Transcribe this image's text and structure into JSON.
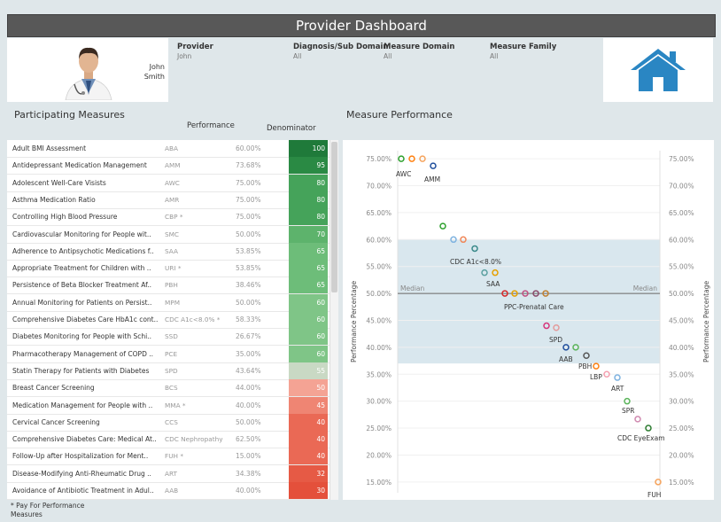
{
  "header": {
    "title": "Provider Dashboard",
    "provider_name": "John\nSmith",
    "filters": [
      {
        "label": "Provider",
        "value": "John"
      },
      {
        "label": "Diagnosis/Sub Domain",
        "value": "All"
      },
      {
        "label": "Measure Domain",
        "value": "All"
      },
      {
        "label": "Measure Family",
        "value": "All"
      }
    ],
    "home_icon": "home-icon",
    "accent_color": "#2a86c3"
  },
  "left_panel": {
    "title": "Participating Measures",
    "col_performance": "Performance",
    "col_denominator": "Denominator",
    "footnote_line1": "* Pay For Performance",
    "footnote_line2": "Measures",
    "rows": [
      {
        "name": "Adult BMI Assessment",
        "abbr": "ABA",
        "perf": "60.00%",
        "denom": "100",
        "color": "#1f7a3a"
      },
      {
        "name": "Antidepressant Medication Management",
        "abbr": "AMM",
        "perf": "73.68%",
        "denom": "95",
        "color": "#2a8a44"
      },
      {
        "name": "Adolescent Well-Care Visists",
        "abbr": "AWC",
        "perf": "75.00%",
        "denom": "80",
        "color": "#45a35a"
      },
      {
        "name": "Asthma Medication Ratio",
        "abbr": "AMR",
        "perf": "75.00%",
        "denom": "80",
        "color": "#45a35a"
      },
      {
        "name": "Controlling High Blood Pressure",
        "abbr": "CBP *",
        "perf": "75.00%",
        "denom": "80",
        "color": "#45a35a"
      },
      {
        "name": "Cardiovascular Monitoring for People wit..",
        "abbr": "SMC",
        "perf": "50.00%",
        "denom": "70",
        "color": "#5db36c"
      },
      {
        "name": "Adherence to Antipsychotic Medications f..",
        "abbr": "SAA",
        "perf": "53.85%",
        "denom": "65",
        "color": "#6dbd79"
      },
      {
        "name": "Appropriate Treatment for Children with ..",
        "abbr": "URI *",
        "perf": "53.85%",
        "denom": "65",
        "color": "#6dbd79"
      },
      {
        "name": "Persistence of Beta Blocker Treatment Af..",
        "abbr": "PBH",
        "perf": "38.46%",
        "denom": "65",
        "color": "#6dbd79"
      },
      {
        "name": "Annual Monitoring for Patients on Persist..",
        "abbr": "MPM",
        "perf": "50.00%",
        "denom": "60",
        "color": "#7fc587"
      },
      {
        "name": "Comprehensive Diabetes Care HbA1c cont..",
        "abbr": "CDC A1c<8.0% *",
        "perf": "58.33%",
        "denom": "60",
        "color": "#7fc587"
      },
      {
        "name": "Diabetes Monitoring  for People with Schi..",
        "abbr": "SSD",
        "perf": "26.67%",
        "denom": "60",
        "color": "#7fc587"
      },
      {
        "name": "Pharmacotherapy Management of COPD ..",
        "abbr": "PCE",
        "perf": "35.00%",
        "denom": "60",
        "color": "#7fc587"
      },
      {
        "name": "Statin Therapy for Patients with Diabetes",
        "abbr": "SPD",
        "perf": "43.64%",
        "denom": "55",
        "color": "#c9d9c4"
      },
      {
        "name": "Breast Cancer Screening",
        "abbr": "BCS",
        "perf": "44.00%",
        "denom": "50",
        "color": "#f4a394"
      },
      {
        "name": "Medication Management for People with ..",
        "abbr": "MMA *",
        "perf": "40.00%",
        "denom": "45",
        "color": "#ef8573"
      },
      {
        "name": "Cervical Cancer Screening",
        "abbr": "CCS",
        "perf": "50.00%",
        "denom": "40",
        "color": "#ea6955"
      },
      {
        "name": "Comprehensive Diabetes Care: Medical At..",
        "abbr": "CDC Nephropathy",
        "perf": "62.50%",
        "denom": "40",
        "color": "#ea6955"
      },
      {
        "name": "Follow-Up after Hospitalization for Ment..",
        "abbr": "FUH *",
        "perf": "15.00%",
        "denom": "40",
        "color": "#ea6955"
      },
      {
        "name": "Disease-Modifying Anti-Rheumatic Drug ..",
        "abbr": "ART",
        "perf": "34.38%",
        "denom": "32",
        "color": "#e65a45"
      },
      {
        "name": "Avoidance of Antibiotic Treatment in Adul..",
        "abbr": "AAB",
        "perf": "40.00%",
        "denom": "30",
        "color": "#e4503b"
      }
    ]
  },
  "right_panel": {
    "title": "Measure Performance"
  },
  "chart_data": {
    "type": "scatter",
    "title": "Measure Performance",
    "ylabel": "Performance Percentage",
    "ylim": [
      13.0,
      76.5
    ],
    "y_ticks": [
      "75.00%",
      "70.00%",
      "65.00%",
      "60.00%",
      "55.00%",
      "50.00%",
      "45.00%",
      "40.00%",
      "35.00%",
      "30.00%",
      "25.00%",
      "20.00%",
      "15.00%"
    ],
    "tick_values": [
      75,
      70,
      65,
      60,
      55,
      50,
      45,
      40,
      35,
      30,
      25,
      20,
      15
    ],
    "band": [
      37.0,
      60.0
    ],
    "median": 50.0,
    "median_label": "Median",
    "points": [
      {
        "y": 75.0,
        "color": "#2ca02c"
      },
      {
        "y": 75.0,
        "color": "#ff7f0e"
      },
      {
        "y": 75.0,
        "color": "#f5a35c"
      },
      {
        "y": 73.68,
        "color": "#1f4e9c"
      },
      {
        "y": 62.5,
        "color": "#2ca02c"
      },
      {
        "y": 60.0,
        "color": "#7fb3e0"
      },
      {
        "y": 60.0,
        "color": "#f0885a"
      },
      {
        "y": 58.33,
        "color": "#3a8a8a"
      },
      {
        "y": 53.85,
        "color": "#5aa0a0"
      },
      {
        "y": 53.85,
        "color": "#e6a000"
      },
      {
        "y": 50.0,
        "color": "#d62728"
      },
      {
        "y": 50.0,
        "color": "#e6a000"
      },
      {
        "y": 50.0,
        "color": "#c05080"
      },
      {
        "y": 50.0,
        "color": "#8a4a6a"
      },
      {
        "y": 50.0,
        "color": "#c08030"
      },
      {
        "y": 44.0,
        "color": "#d6357a"
      },
      {
        "y": 43.64,
        "color": "#e39a9a"
      },
      {
        "y": 40.0,
        "color": "#1f4e9c"
      },
      {
        "y": 40.0,
        "color": "#5ab45a"
      },
      {
        "y": 38.46,
        "color": "#555555"
      },
      {
        "y": 36.5,
        "color": "#ff7f0e"
      },
      {
        "y": 35.0,
        "color": "#f5a0b0"
      },
      {
        "y": 34.38,
        "color": "#7fb3e0"
      },
      {
        "y": 30.0,
        "color": "#5ab45a"
      },
      {
        "y": 26.67,
        "color": "#d08ab0"
      },
      {
        "y": 25.0,
        "color": "#2e7d32"
      },
      {
        "y": 15.0,
        "color": "#f5a35c"
      }
    ],
    "labels": [
      {
        "text": "AWC"
      },
      {
        "text": "AMM"
      },
      {
        "text": "CDC A1c<8.0%"
      },
      {
        "text": "SAA"
      },
      {
        "text": "PPC-Prenatal Care"
      },
      {
        "text": "SPD"
      },
      {
        "text": "AAB"
      },
      {
        "text": "PBH"
      },
      {
        "text": "LBP"
      },
      {
        "text": "ART"
      },
      {
        "text": "SPR"
      },
      {
        "text": "CDC EyeExam"
      },
      {
        "text": "FUH"
      }
    ]
  }
}
